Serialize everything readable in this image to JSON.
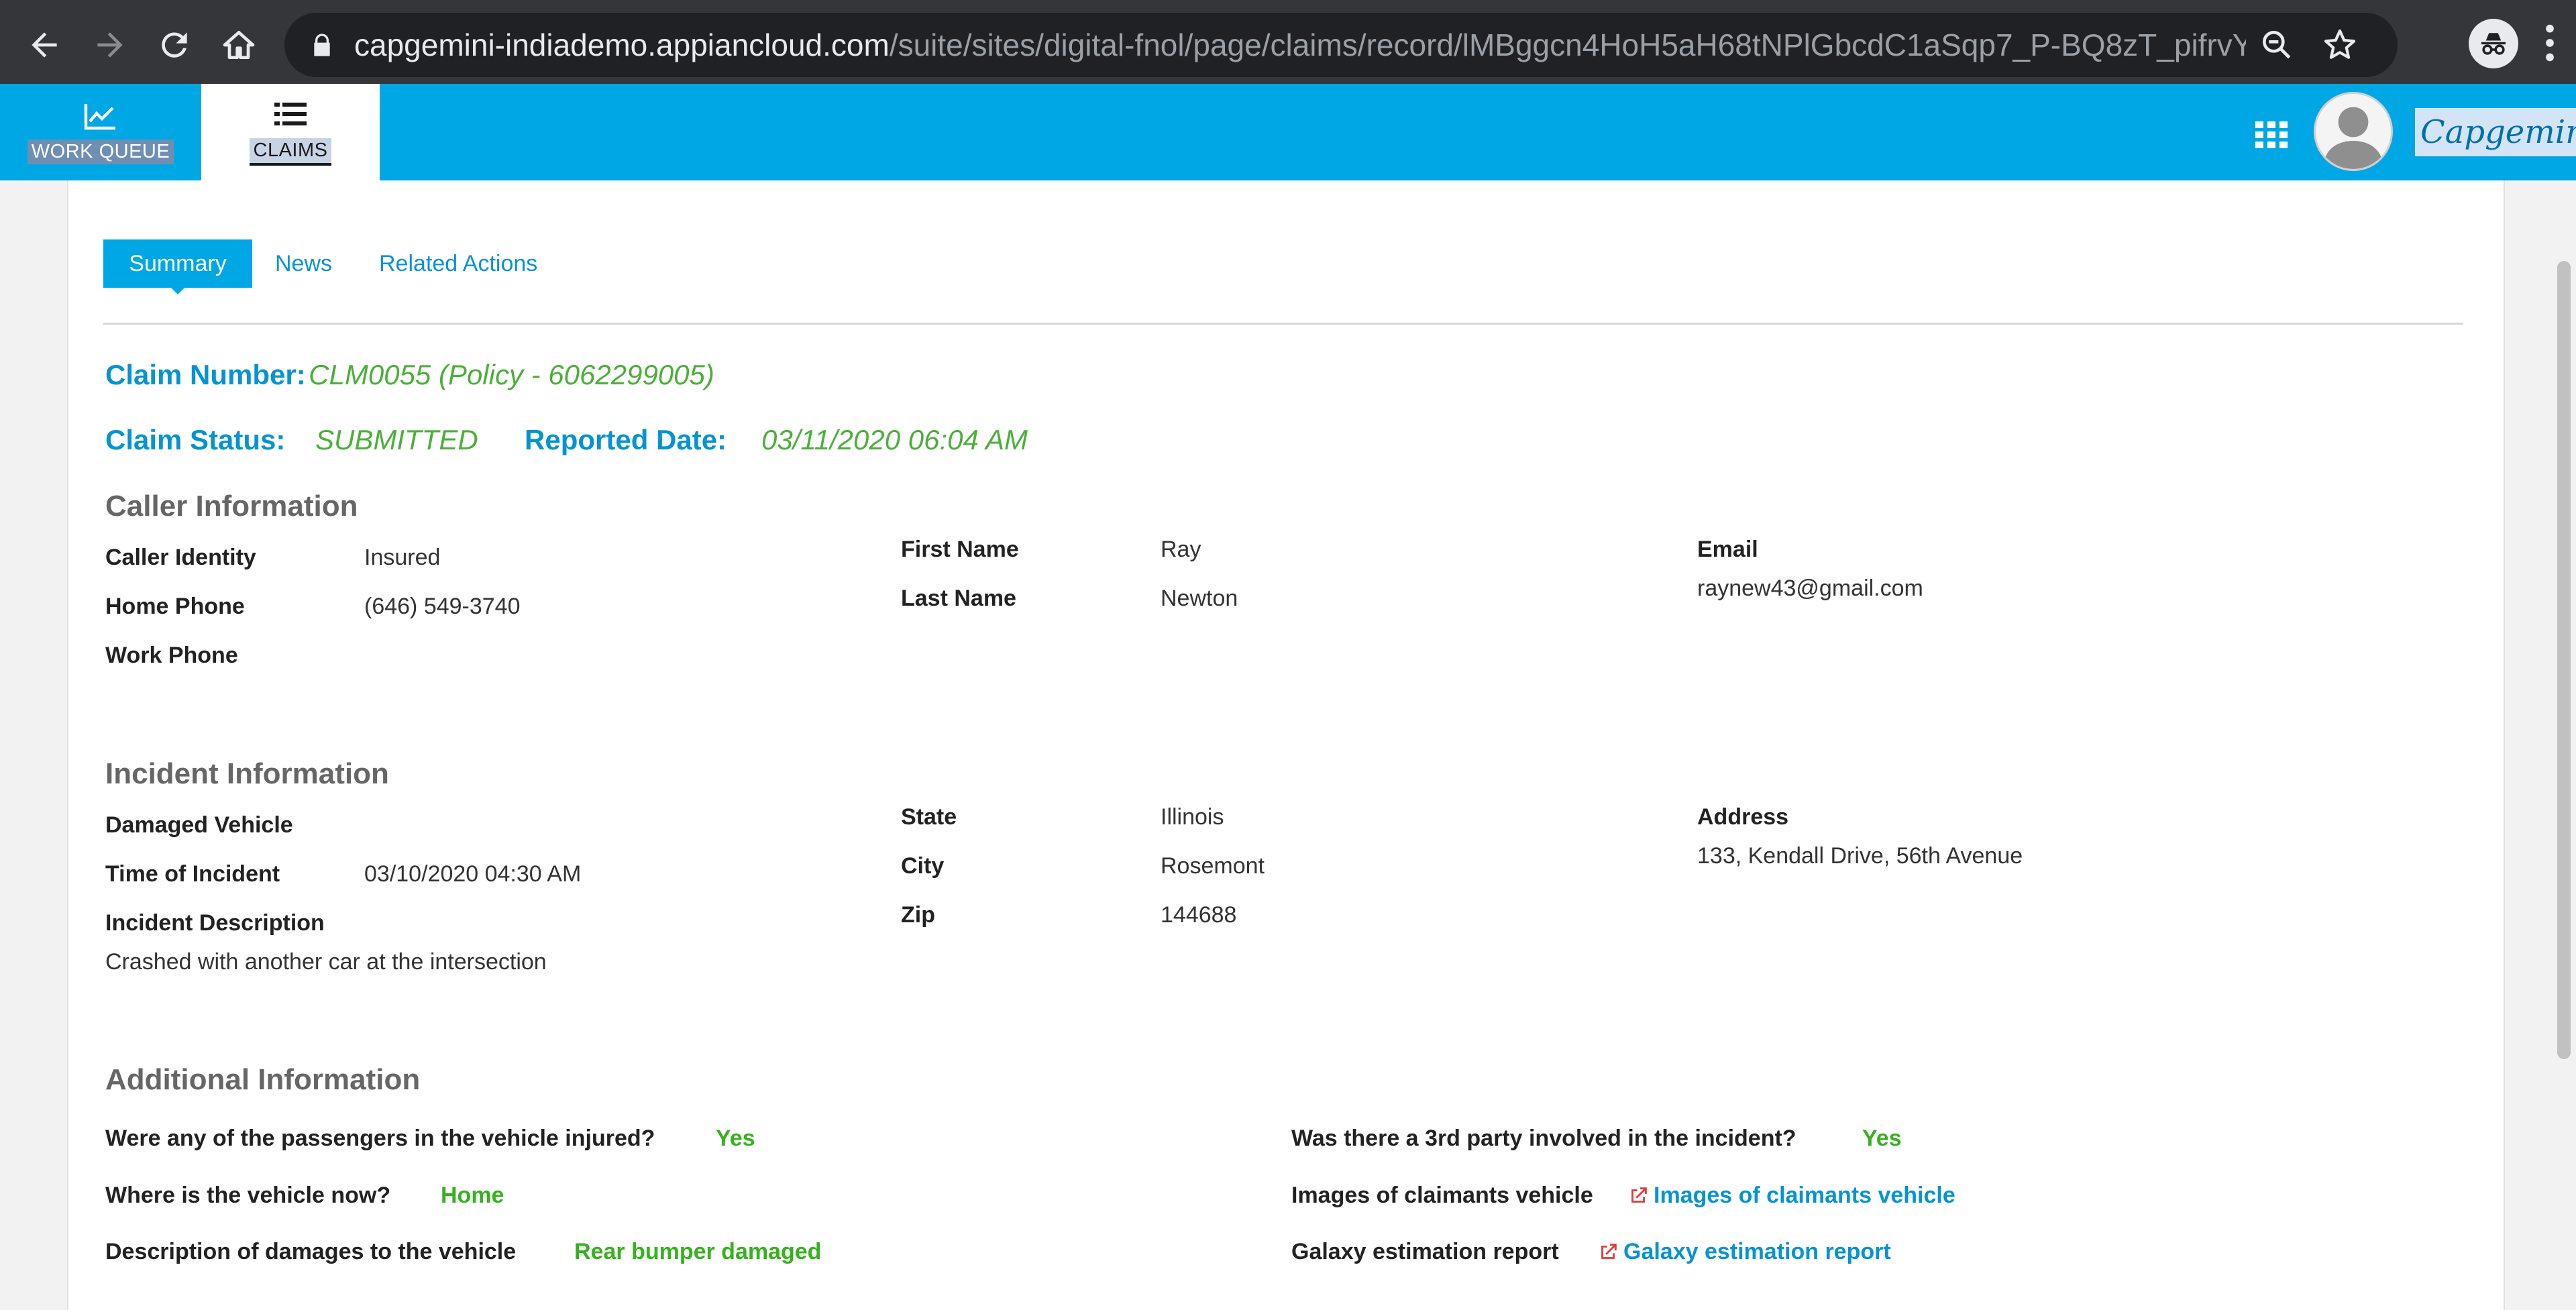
{
  "browser": {
    "url_host": "capgemini-indiademo.appiancloud.com",
    "url_path": "/suite/sites/digital-fnol/page/claims/record/lMBggcn4HoH5aH68tNPlGbcdC1aSqp7_P-BQ8zT_pifrvYUggO5Re1B_..."
  },
  "header": {
    "tabs": [
      {
        "label": "WORK QUEUE",
        "icon": "line-chart-icon"
      },
      {
        "label": "CLAIMS",
        "icon": "list-icon"
      }
    ],
    "brand": "Capgemini"
  },
  "record_tabs": {
    "summary": "Summary",
    "news": "News",
    "related_actions": "Related Actions"
  },
  "claim": {
    "number_label": "Claim Number:",
    "number_value": "CLM0055 (Policy - 6062299005)",
    "status_label": "Claim Status:",
    "status_value": "SUBMITTED",
    "reported_label": "Reported Date:",
    "reported_value": "03/11/2020 06:04 AM"
  },
  "caller": {
    "title": "Caller Information",
    "caller_identity_label": "Caller Identity",
    "caller_identity_value": "Insured",
    "home_phone_label": "Home Phone",
    "home_phone_value": "(646) 549-3740",
    "work_phone_label": "Work Phone",
    "first_name_label": "First Name",
    "first_name_value": "Ray",
    "last_name_label": "Last Name",
    "last_name_value": "Newton",
    "email_label": "Email",
    "email_value": "raynew43@gmail.com"
  },
  "incident": {
    "title": "Incident Information",
    "damaged_vehicle_label": "Damaged Vehicle",
    "time_label": "Time of Incident",
    "time_value": "03/10/2020 04:30 AM",
    "description_label": "Incident Description",
    "description_value": "Crashed with another car at the intersection",
    "state_label": "State",
    "state_value": "Illinois",
    "city_label": "City",
    "city_value": "Rosemont",
    "zip_label": "Zip",
    "zip_value": "144688",
    "address_label": "Address",
    "address_value": "133, Kendall Drive, 56th Avenue"
  },
  "additional": {
    "title": "Additional Information",
    "injured_label": "Were any of the passengers in the vehicle injured?",
    "injured_value": "Yes",
    "vehicle_location_label": "Where is the vehicle now?",
    "vehicle_location_value": "Home",
    "damages_label": "Description of damages to the vehicle",
    "damages_value": "Rear bumper damaged",
    "third_party_label": "Was there a 3rd party involved in the incident?",
    "third_party_value": "Yes",
    "images_label": "Images of claimants vehicle",
    "images_link": "Images of claimants vehicle",
    "galaxy_label": "Galaxy estimation report",
    "galaxy_link": "Galaxy estimation report"
  },
  "colors": {
    "header_blue": "#00a7e5",
    "link_blue": "#0693d2",
    "value_green": "#36b21f"
  }
}
